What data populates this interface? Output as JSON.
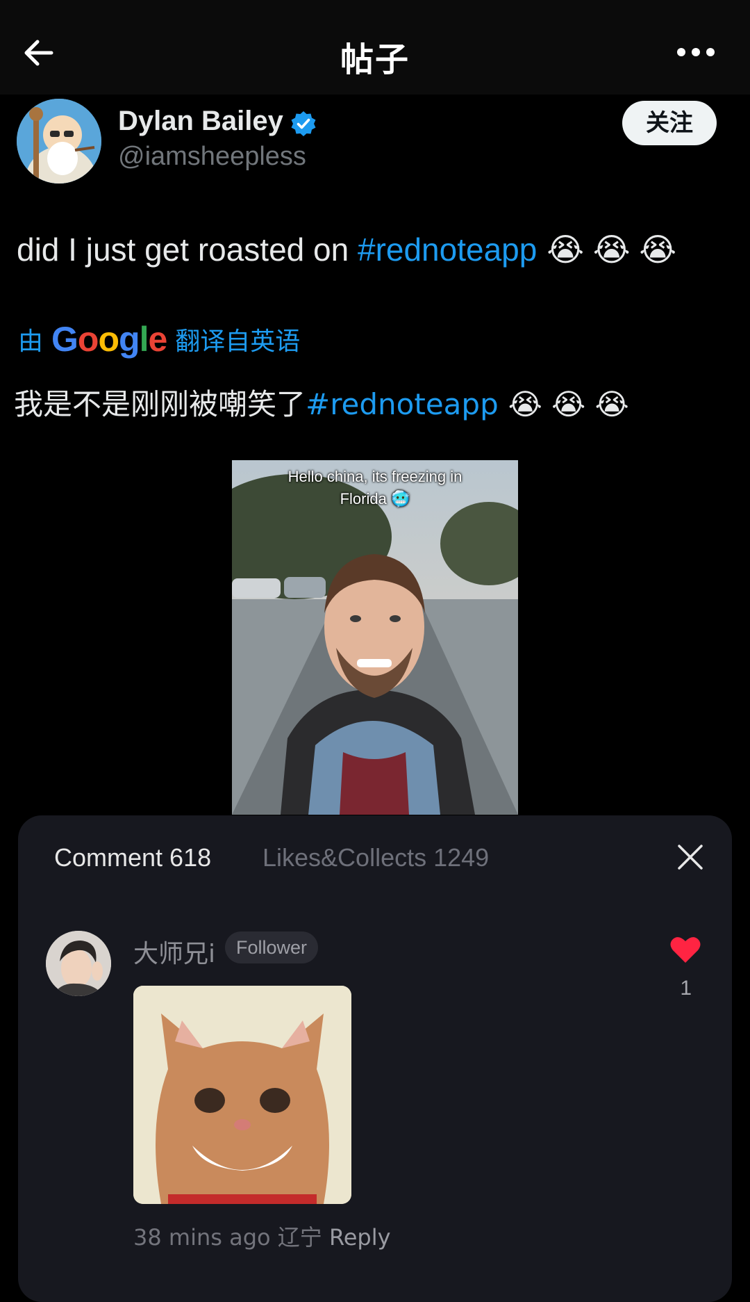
{
  "header": {
    "title": "帖子",
    "back_icon": "arrow-left-icon",
    "more_icon": "more-horizontal-icon"
  },
  "author": {
    "name": "Dylan Bailey",
    "handle": "@iamsheepless",
    "verified": true,
    "verified_color": "#1d9bf0",
    "follow_label": "关注"
  },
  "post": {
    "text_prefix": "did I just get roasted on ",
    "hashtag": "#rednoteapp",
    "emojis": "😭 😭 😭",
    "translate_prefix": "由",
    "translate_brand": "Google",
    "translate_suffix": "翻译自英语",
    "translated_prefix": "我是不是刚刚被嘲笑了",
    "translated_hashtag": "#rednoteapp",
    "translated_emojis": "😭 😭 😭",
    "media_caption_line1": "Hello china, its freezing in",
    "media_caption_line2": "Florida 🥶"
  },
  "comments_sheet": {
    "tab_comments": "Comment 618",
    "tab_likes": "Likes&Collects 1249",
    "close_icon": "close-icon",
    "comment": {
      "username": "大师兄i",
      "badge": "Follower",
      "likes": "1",
      "like_color": "#ff2442",
      "time": "38 mins ago",
      "location": "辽宁",
      "reply_label": "Reply"
    }
  },
  "colors": {
    "link": "#1d9bf0",
    "background": "#000000",
    "sheet": "#17181f"
  }
}
